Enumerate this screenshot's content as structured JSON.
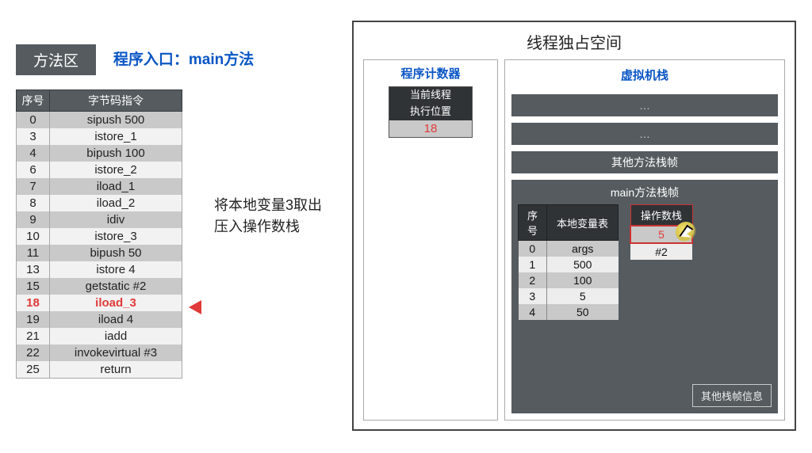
{
  "left": {
    "methodAreaTag": "方法区",
    "entryLabel": "程序入口：main方法",
    "tableHeaders": {
      "idx": "序号",
      "instr": "字节码指令"
    },
    "bytecode": [
      {
        "idx": "0",
        "instr": "sipush 500"
      },
      {
        "idx": "3",
        "instr": "istore_1"
      },
      {
        "idx": "4",
        "instr": "bipush 100"
      },
      {
        "idx": "6",
        "instr": "istore_2"
      },
      {
        "idx": "7",
        "instr": "iload_1"
      },
      {
        "idx": "8",
        "instr": "iload_2"
      },
      {
        "idx": "9",
        "instr": "idiv"
      },
      {
        "idx": "10",
        "instr": "istore_3"
      },
      {
        "idx": "11",
        "instr": "bipush 50"
      },
      {
        "idx": "13",
        "instr": "istore 4"
      },
      {
        "idx": "15",
        "instr": "getstatic #2"
      },
      {
        "idx": "18",
        "instr": "iload_3",
        "current": true
      },
      {
        "idx": "19",
        "instr": "iload 4"
      },
      {
        "idx": "21",
        "instr": "iadd"
      },
      {
        "idx": "22",
        "instr": "invokevirtual #3"
      },
      {
        "idx": "25",
        "instr": "return"
      }
    ],
    "annotation": {
      "l1": "将本地变量3取出",
      "l2": "压入操作数栈"
    }
  },
  "right": {
    "title": "线程独占空间",
    "pc": {
      "title": "程序计数器",
      "hdr1": "当前线程",
      "hdr2": "执行位置",
      "value": "18"
    },
    "vm": {
      "title": "虚拟机栈",
      "ellipsis": "…",
      "otherFrames": "其他方法栈帧",
      "mainFrameTitle": "main方法栈帧",
      "localsHeaders": {
        "idx": "序号",
        "name": "本地变量表"
      },
      "locals": [
        {
          "idx": "0",
          "val": "args"
        },
        {
          "idx": "1",
          "val": "500"
        },
        {
          "idx": "2",
          "val": "100"
        },
        {
          "idx": "3",
          "val": "5"
        },
        {
          "idx": "4",
          "val": "50"
        }
      ],
      "opHeader": "操作数栈",
      "opstack": [
        {
          "val": "5",
          "mark": true
        },
        {
          "val": "#2"
        }
      ],
      "otherInfo": "其他栈帧信息"
    }
  }
}
